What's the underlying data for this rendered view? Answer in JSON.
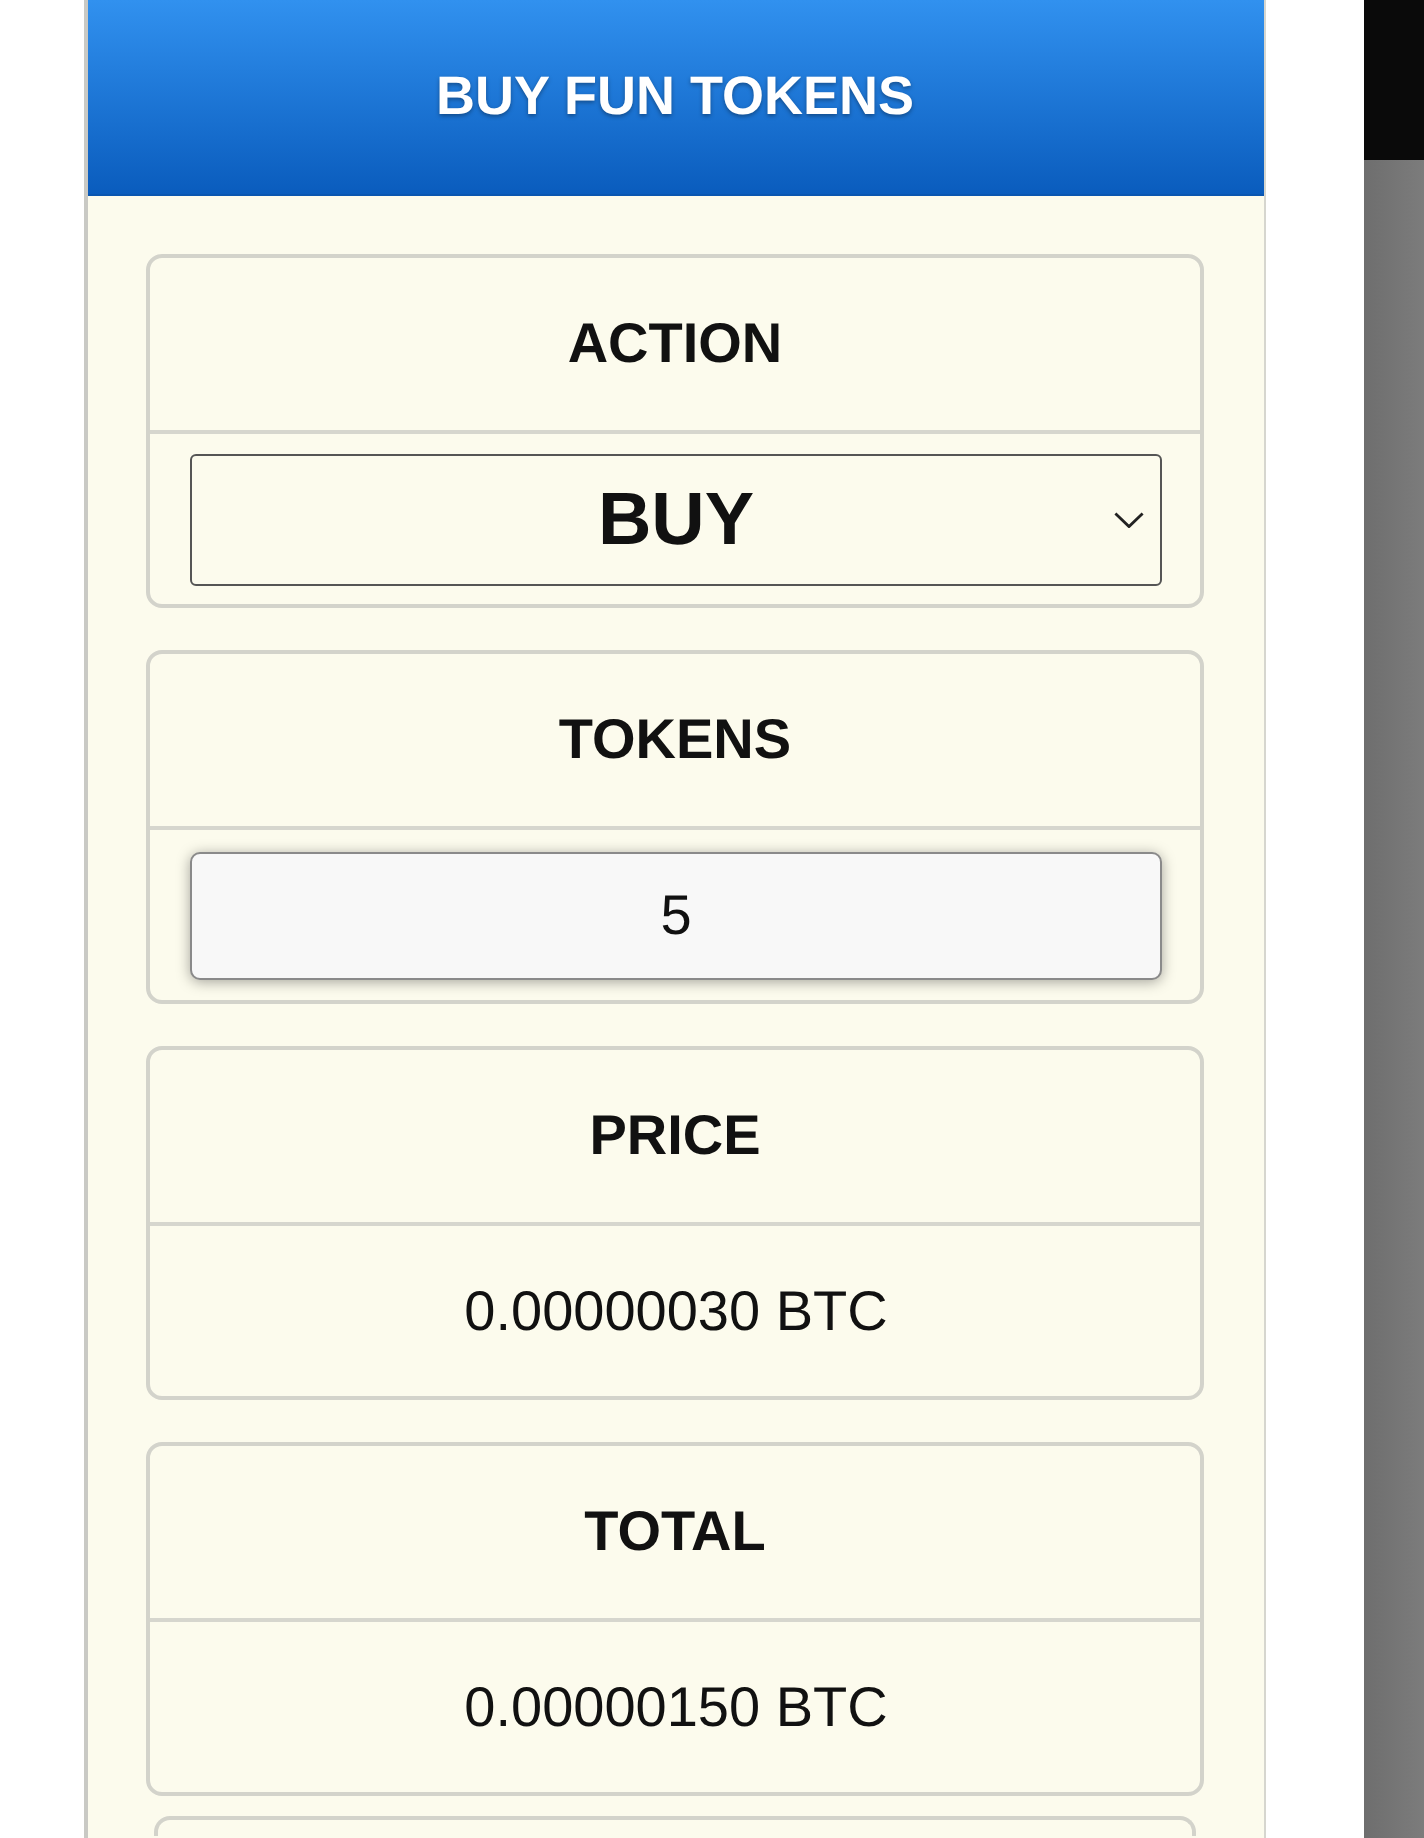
{
  "header": {
    "title": "BUY FUN TOKENS"
  },
  "fields": [
    {
      "kind": "select",
      "label": "ACTION",
      "value": "BUY"
    },
    {
      "kind": "input",
      "label": "TOKENS",
      "value": "5"
    },
    {
      "kind": "output",
      "label": "PRICE",
      "value": "0.00000030 BTC"
    },
    {
      "kind": "output",
      "label": "TOTAL",
      "value": "0.00000150 BTC"
    }
  ]
}
